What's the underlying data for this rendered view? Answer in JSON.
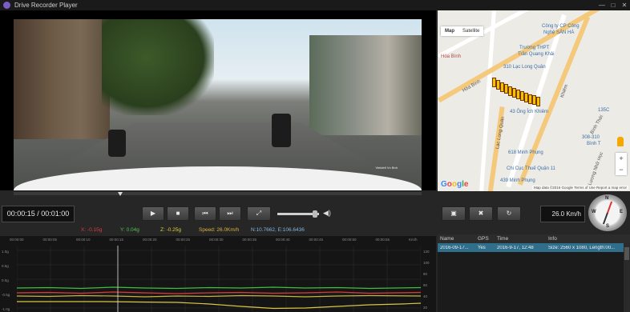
{
  "window": {
    "title": "Drive Recorder Player",
    "buttons": [
      "—",
      "□",
      "✕"
    ]
  },
  "video": {
    "stamp": "Vietdefi  Vn  Bnh"
  },
  "map": {
    "tabs": [
      "Map",
      "Satellite"
    ],
    "labels": [
      "Công ty CP Công",
      "Nghệ SẢN HÀ",
      "Trường THPT",
      "Trần Quang Khải",
      "310 Lạc Long Quân",
      "Hòa Bình",
      "43 Ông Ích Khiêm",
      "618 Minh Phụng",
      "Chi Cục Thuế Quận 11",
      "439 Minh Phụng",
      "Lạc Long Quân",
      "Bình Thới",
      "Khiêm",
      "135C",
      "308-310",
      "Bình T",
      "Lương Nhữ Học",
      "Hòa Bình"
    ],
    "google": [
      "G",
      "o",
      "o",
      "g",
      "l",
      "e"
    ],
    "attribution": "Map data ©2016 Google    Terms of Use    Report a map error",
    "zoom_in": "+",
    "zoom_out": "−"
  },
  "playback": {
    "time": "00:00:15 / 00:01:00",
    "buttons": {
      "play": "▶",
      "stop": "■",
      "prev": "⏮",
      "next": "⏭",
      "fullscreen": "⤢"
    },
    "volume": 0.9,
    "volume_icon": "◀)",
    "speed": "26.0 Km/h",
    "right_buttons": {
      "snapshot": "▣",
      "delete": "✖",
      "refresh": "↻"
    },
    "compass": {
      "n": "N",
      "s": "S",
      "w": "W",
      "e": "E"
    }
  },
  "sensor": {
    "x": "X: -0.15g",
    "y": "Y: 0.04g",
    "z": "Z: -0.25g",
    "speed": "Speed: 26.0Km/h",
    "coords": "N:10.7662, E:106.6436",
    "colors": {
      "x": "#e03b3b",
      "y": "#4fc14f",
      "z": "#e0cf3b",
      "speed": "#e0b040",
      "coords": "#7fb6e0"
    }
  },
  "graph": {
    "time_ticks": [
      "00:00:00",
      "00:00:05",
      "00:00:10",
      "00:00:15",
      "00:00:20",
      "00:00:25",
      "00:00:30",
      "00:00:35",
      "00:00:40",
      "00:00:45",
      "00:00:50",
      "00:00:55",
      "Km/h"
    ],
    "left_ticks": [
      "1.0g",
      "0.5g",
      "0.0g",
      "-0.5g",
      "-1.0g"
    ],
    "right_ticks": [
      "120",
      "100",
      "80",
      "60",
      "40",
      "20"
    ],
    "cursor_time": 15
  },
  "files": {
    "columns": [
      "Name",
      "GPS",
      "Time",
      "Info"
    ],
    "rows": [
      {
        "name": "2016-09-17...",
        "gps": "Yes",
        "time": "2016-9-17, 12:48",
        "info": "Size: 2560 x 1080, Length:00..."
      }
    ]
  }
}
